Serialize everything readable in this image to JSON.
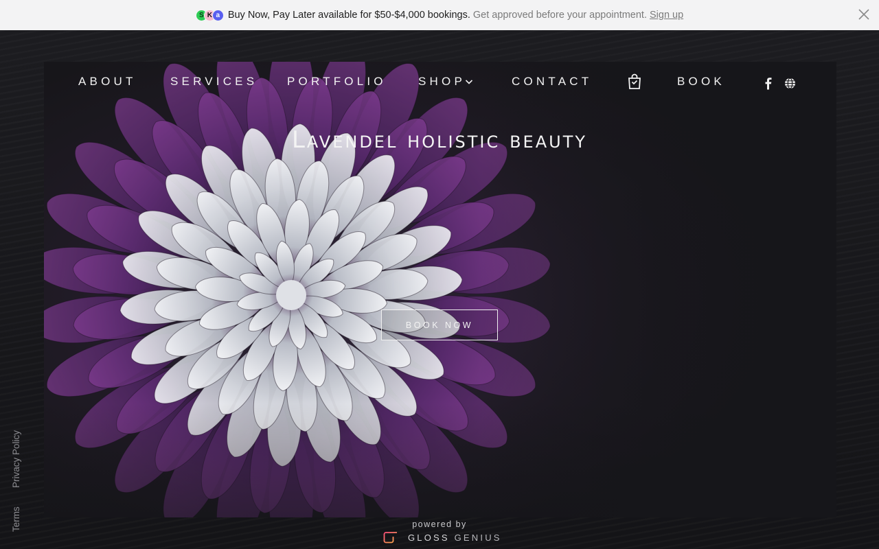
{
  "banner": {
    "logos": [
      "afterpay-logo",
      "klarna-logo",
      "affirm-logo"
    ],
    "logo_glyphs": [
      "S",
      "K",
      "a"
    ],
    "main_text": "Buy Now, Pay Later available for $50-$4,000 bookings.",
    "sub_text": "Get approved before your appointment.",
    "signup_label": "Sign up",
    "close_icon": "close-icon"
  },
  "nav": {
    "items": [
      {
        "label": "ABOUT"
      },
      {
        "label": "SERVICES"
      },
      {
        "label": "PORTFOLIO"
      },
      {
        "label": "SHOP"
      },
      {
        "label": "CONTACT"
      },
      {
        "label": "BOOK"
      }
    ],
    "shop_icon": "chevron-down-icon",
    "cart_icon": "shopping-bag-icon",
    "social_icons": [
      "facebook-icon",
      "globe-icon"
    ]
  },
  "hero": {
    "title": "Lavendel holistic beauty",
    "cta_label": "BOOK NOW"
  },
  "side_links": {
    "privacy": "Privacy Policy",
    "terms": "Terms"
  },
  "footer": {
    "powered_by": "powered by",
    "brand_part1": "GLOSS",
    "brand_part2": "GENIUS"
  },
  "colors": {
    "background": "#131317",
    "banner_bg": "#f3f3f4",
    "petal_purple": "#5a2a6a",
    "petal_white": "#d9dbe0"
  }
}
